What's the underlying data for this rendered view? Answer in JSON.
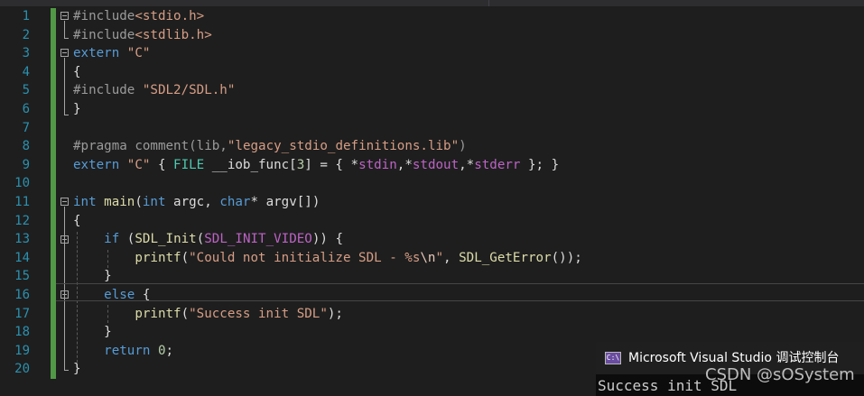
{
  "editor": {
    "line_numbers": [
      "1",
      "2",
      "3",
      "4",
      "5",
      "6",
      "7",
      "8",
      "9",
      "10",
      "11",
      "12",
      "13",
      "14",
      "15",
      "16",
      "17",
      "18",
      "19",
      "20"
    ],
    "colors": {
      "background": "#1e1e1e",
      "line_number": "#2b91af",
      "keyword": "#569cd6",
      "string": "#d69d85",
      "function": "#dcdcaa",
      "macro": "#bd63c5",
      "changebar": "#57a64a"
    },
    "lines": [
      [
        {
          "t": "#include",
          "c": "pp"
        },
        {
          "t": "<stdio.h>",
          "c": "str"
        }
      ],
      [
        {
          "t": "#include",
          "c": "pp"
        },
        {
          "t": "<stdlib.h>",
          "c": "str"
        }
      ],
      [
        {
          "t": "extern",
          "c": "kw"
        },
        {
          "t": " ",
          "c": ""
        },
        {
          "t": "\"C\"",
          "c": "str"
        }
      ],
      [
        {
          "t": "{",
          "c": ""
        }
      ],
      [
        {
          "t": "#include",
          "c": "pp"
        },
        {
          "t": " ",
          "c": ""
        },
        {
          "t": "\"SDL2/SDL.h\"",
          "c": "str"
        }
      ],
      [
        {
          "t": "}",
          "c": ""
        }
      ],
      [],
      [
        {
          "t": "#pragma",
          "c": "pp"
        },
        {
          "t": " comment",
          "c": "pp"
        },
        {
          "t": "(lib,",
          "c": "pp"
        },
        {
          "t": "\"legacy_stdio_definitions.lib\"",
          "c": "str"
        },
        {
          "t": ")",
          "c": "pp"
        }
      ],
      [
        {
          "t": "extern",
          "c": "kw"
        },
        {
          "t": " ",
          "c": ""
        },
        {
          "t": "\"C\"",
          "c": "str"
        },
        {
          "t": " { ",
          "c": ""
        },
        {
          "t": "FILE",
          "c": "typ"
        },
        {
          "t": " __iob_func[",
          "c": ""
        },
        {
          "t": "3",
          "c": "num"
        },
        {
          "t": "] = { *",
          "c": ""
        },
        {
          "t": "stdin",
          "c": "mac"
        },
        {
          "t": ",*",
          "c": ""
        },
        {
          "t": "stdout",
          "c": "mac"
        },
        {
          "t": ",*",
          "c": ""
        },
        {
          "t": "stderr",
          "c": "mac"
        },
        {
          "t": " }; }",
          "c": ""
        }
      ],
      [],
      [
        {
          "t": "int",
          "c": "kw"
        },
        {
          "t": " ",
          "c": ""
        },
        {
          "t": "main",
          "c": "fn"
        },
        {
          "t": "(",
          "c": ""
        },
        {
          "t": "int",
          "c": "kw"
        },
        {
          "t": " argc, ",
          "c": ""
        },
        {
          "t": "char",
          "c": "kw"
        },
        {
          "t": "* argv[])",
          "c": ""
        }
      ],
      [
        {
          "t": "{",
          "c": ""
        }
      ],
      [
        {
          "t": "    ",
          "c": ""
        },
        {
          "t": "if",
          "c": "kw"
        },
        {
          "t": " (",
          "c": ""
        },
        {
          "t": "SDL_Init",
          "c": "fn"
        },
        {
          "t": "(",
          "c": ""
        },
        {
          "t": "SDL_INIT_VIDEO",
          "c": "mac"
        },
        {
          "t": ")) {",
          "c": ""
        }
      ],
      [
        {
          "t": "        ",
          "c": ""
        },
        {
          "t": "printf",
          "c": "fn"
        },
        {
          "t": "(",
          "c": ""
        },
        {
          "t": "\"Could not initialize SDL - %s",
          "c": "str"
        },
        {
          "t": "\\n",
          "c": "esc"
        },
        {
          "t": "\"",
          "c": "str"
        },
        {
          "t": ", ",
          "c": ""
        },
        {
          "t": "SDL_GetError",
          "c": "fn"
        },
        {
          "t": "());",
          "c": ""
        }
      ],
      [
        {
          "t": "    }",
          "c": ""
        }
      ],
      [
        {
          "t": "    ",
          "c": ""
        },
        {
          "t": "else",
          "c": "kw"
        },
        {
          "t": " {",
          "c": ""
        }
      ],
      [
        {
          "t": "        ",
          "c": ""
        },
        {
          "t": "printf",
          "c": "fn"
        },
        {
          "t": "(",
          "c": ""
        },
        {
          "t": "\"Success init SDL\"",
          "c": "str"
        },
        {
          "t": ");",
          "c": ""
        }
      ],
      [
        {
          "t": "    }",
          "c": ""
        }
      ],
      [
        {
          "t": "    ",
          "c": ""
        },
        {
          "t": "return",
          "c": "kw"
        },
        {
          "t": " ",
          "c": ""
        },
        {
          "t": "0",
          "c": "num"
        },
        {
          "t": ";",
          "c": ""
        }
      ],
      [
        {
          "t": "}",
          "c": ""
        }
      ]
    ]
  },
  "console": {
    "title": "Microsoft Visual Studio 调试控制台",
    "icon_label": "C:\\",
    "icon": "console-app-icon",
    "output": "Success init SDL"
  },
  "watermark": "CSDN @sOSystem"
}
